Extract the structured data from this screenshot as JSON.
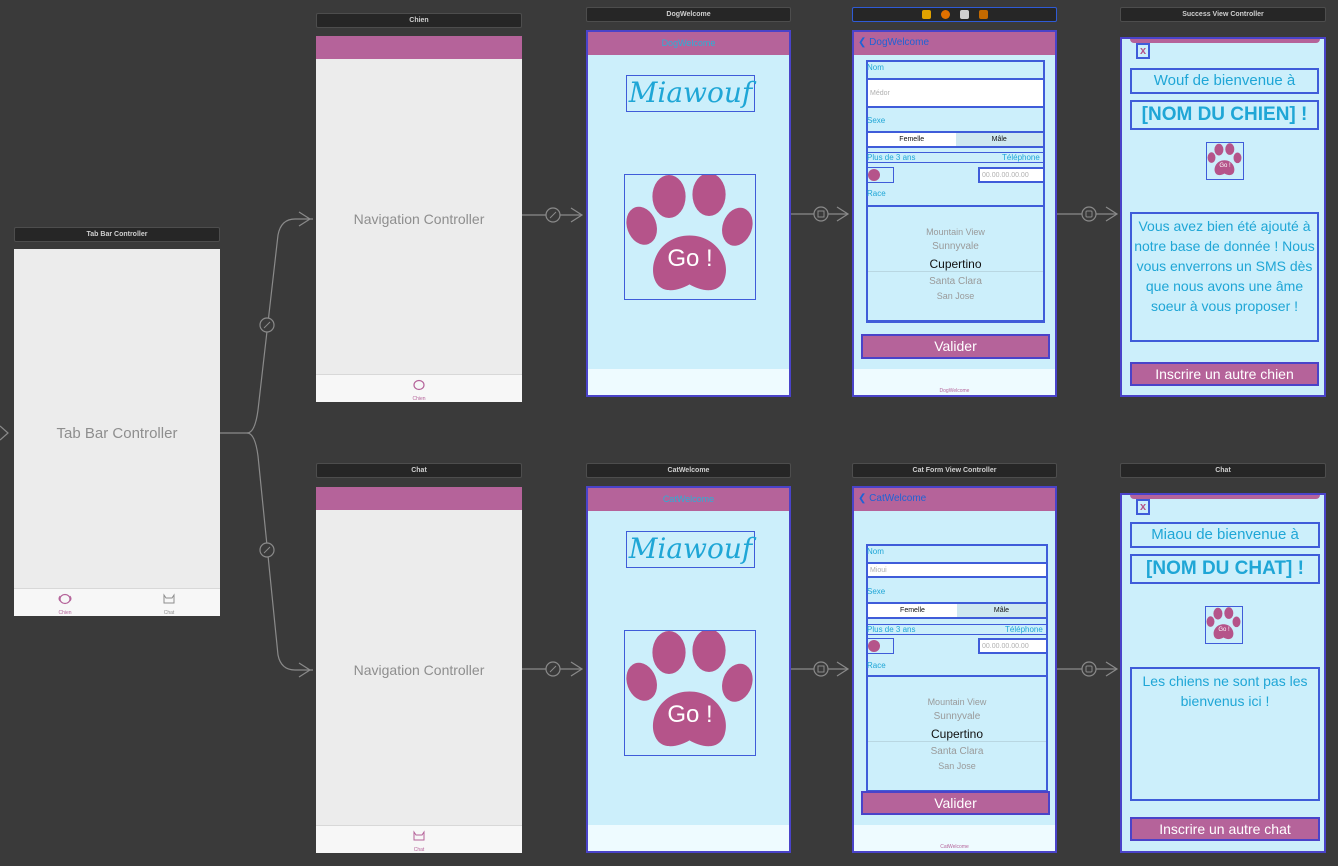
{
  "tabbar_controller": {
    "title": "Tab Bar Controller",
    "label": "Tab Bar Controller",
    "tab1": "Chien",
    "tab2": "Chat"
  },
  "nav_chien": {
    "title": "Chien",
    "label": "Navigation Controller",
    "tab": "Chien"
  },
  "nav_chat": {
    "title": "Chat",
    "label": "Navigation Controller",
    "tab": "Chat"
  },
  "dog_welcome": {
    "title": "DogWelcome",
    "nav_title": "DogWelcome",
    "logo": "Miawouf",
    "go_label": "Go !"
  },
  "cat_welcome": {
    "title": "CatWelcome",
    "nav_title": "CatWelcome",
    "logo": "Miawouf",
    "go_label": "Go !"
  },
  "dog_form": {
    "back": "DogWelcome",
    "nom_label": "Nom",
    "nom_placeholder": "Médor",
    "sexe_label": "Sexe",
    "seg_female": "Femelle",
    "seg_male": "Mâle",
    "age_label": "Plus de 3 ans",
    "phone_label": "Téléphone",
    "phone_placeholder": "00.00.00.00.00",
    "race_label": "Race",
    "picker": [
      "Mountain View",
      "Sunnyvale",
      "Cupertino",
      "Santa Clara",
      "San Jose"
    ],
    "validate": "Valider",
    "bottom_label": "DogWelcome"
  },
  "cat_form": {
    "title": "Cat Form View Controller",
    "back": "CatWelcome",
    "nom_label": "Nom",
    "nom_placeholder": "Mioui",
    "sexe_label": "Sexe",
    "seg_female": "Femelle",
    "seg_male": "Mâle",
    "age_label": "Plus de 3 ans",
    "phone_label": "Téléphone",
    "phone_placeholder": "00.00.00.00.00",
    "race_label": "Race",
    "picker": [
      "Mountain View",
      "Sunnyvale",
      "Cupertino",
      "Santa Clara",
      "San Jose"
    ],
    "validate": "Valider",
    "bottom_label": "CatWelcome"
  },
  "success_dog": {
    "title": "Success View Controller",
    "close": "x",
    "welcome": "Wouf de bienvenue à",
    "name": "[NOM DU CHIEN] !",
    "icon_text": "Go !",
    "message": "Vous avez bien été ajouté à notre base de donnée ! Nous vous enverrons un SMS dès que nous avons une âme soeur à vous proposer !",
    "button": "Inscrire un autre chien"
  },
  "success_cat": {
    "title": "Chat",
    "close": "x",
    "welcome": "Miaou de bienvenue à",
    "name": "[NOM DU CHAT] !",
    "icon_text": "Go !",
    "message": "Les chiens ne sont pas les bienvenus ici !",
    "button": "Inscrire un autre chat"
  },
  "colors": {
    "canvas": "#3a3a3a",
    "pink": "#b5639a",
    "light_blue": "#cceffb",
    "cyan_text": "#1fa6d6",
    "selection_blue": "#3f5cd9"
  }
}
